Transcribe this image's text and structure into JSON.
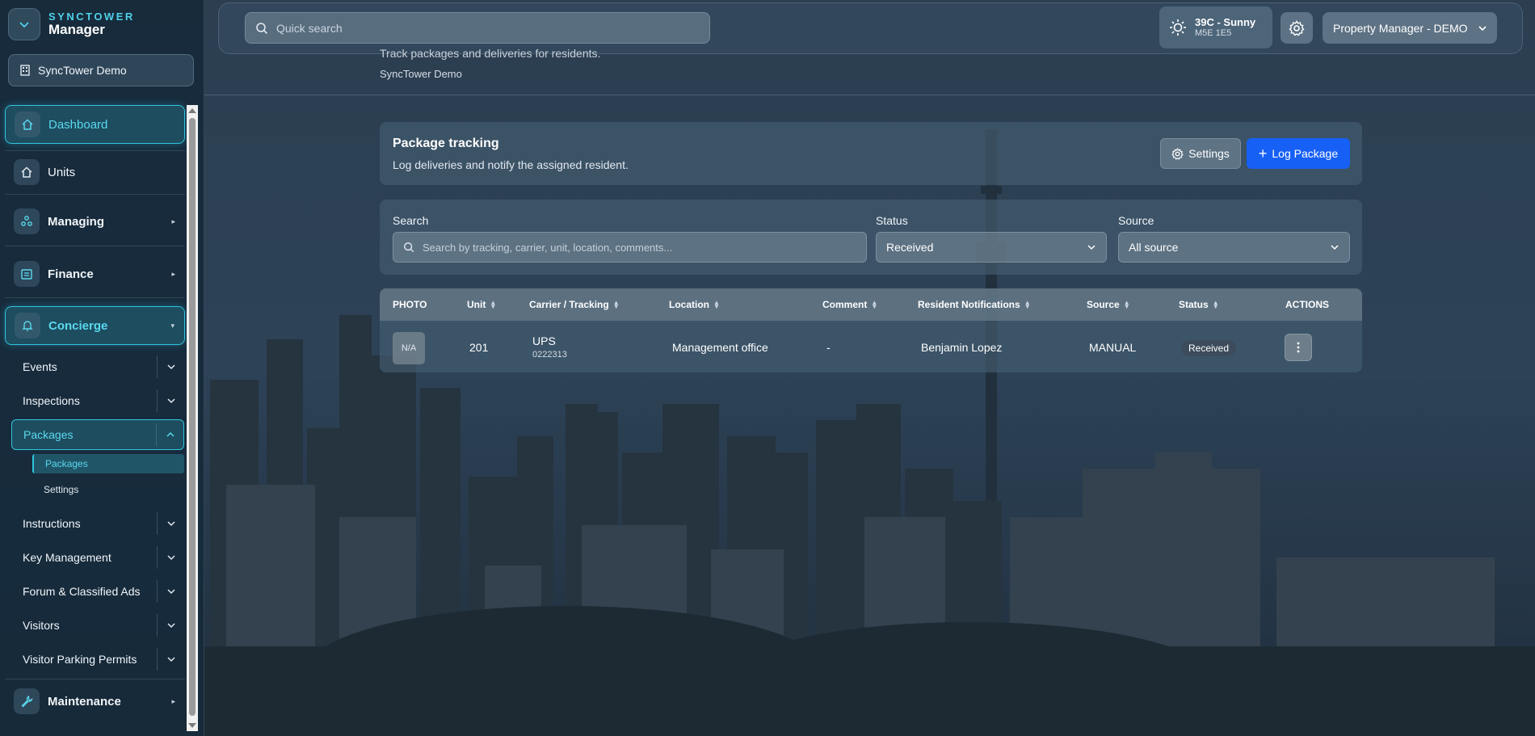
{
  "brand": {
    "top": "SYNCTOWER",
    "bottom": "Manager"
  },
  "org": {
    "name": "SyncTower Demo"
  },
  "sidebar": {
    "dashboard": "Dashboard",
    "units": "Units",
    "managing": "Managing",
    "finance": "Finance",
    "concierge": "Concierge",
    "maintenance": "Maintenance",
    "sub_items": [
      "Events",
      "Inspections",
      "Packages",
      "Instructions",
      "Key Management",
      "Forum & Classified Ads",
      "Visitors",
      "Visitor Parking Permits"
    ],
    "packages_children": [
      "Packages",
      "Settings"
    ]
  },
  "header": {
    "search_placeholder": "Quick search",
    "weather_temp": "39C - Sunny",
    "weather_location": "M5E 1E5",
    "role": "Property Manager - DEMO"
  },
  "page": {
    "subtitle": "Track packages and deliveries for residents.",
    "org": "SyncTower Demo"
  },
  "tracking": {
    "title": "Package tracking",
    "description": "Log deliveries and notify the assigned resident.",
    "settings_label": "Settings",
    "log_label": "Log Package"
  },
  "filters": {
    "search_label": "Search",
    "search_placeholder": "Search by tracking, carrier, unit, location, comments...",
    "status_label": "Status",
    "status_value": "Received",
    "source_label": "Source",
    "source_value": "All source"
  },
  "table": {
    "columns": [
      "PHOTO",
      "Unit",
      "Carrier / Tracking",
      "Location",
      "Comment",
      "Resident Notifications",
      "Source",
      "Status",
      "ACTIONS"
    ],
    "rows": [
      {
        "photo": "N/A",
        "unit": "201",
        "carrier": "UPS",
        "tracking": "0222313",
        "location": "Management office",
        "comment": "-",
        "resident": "Benjamin Lopez",
        "source": "MANUAL",
        "status": "Received"
      }
    ]
  },
  "colors": {
    "accent": "#2fc4dd",
    "primary_button": "#1760f5",
    "sidebar_bg": "#162a3a"
  }
}
